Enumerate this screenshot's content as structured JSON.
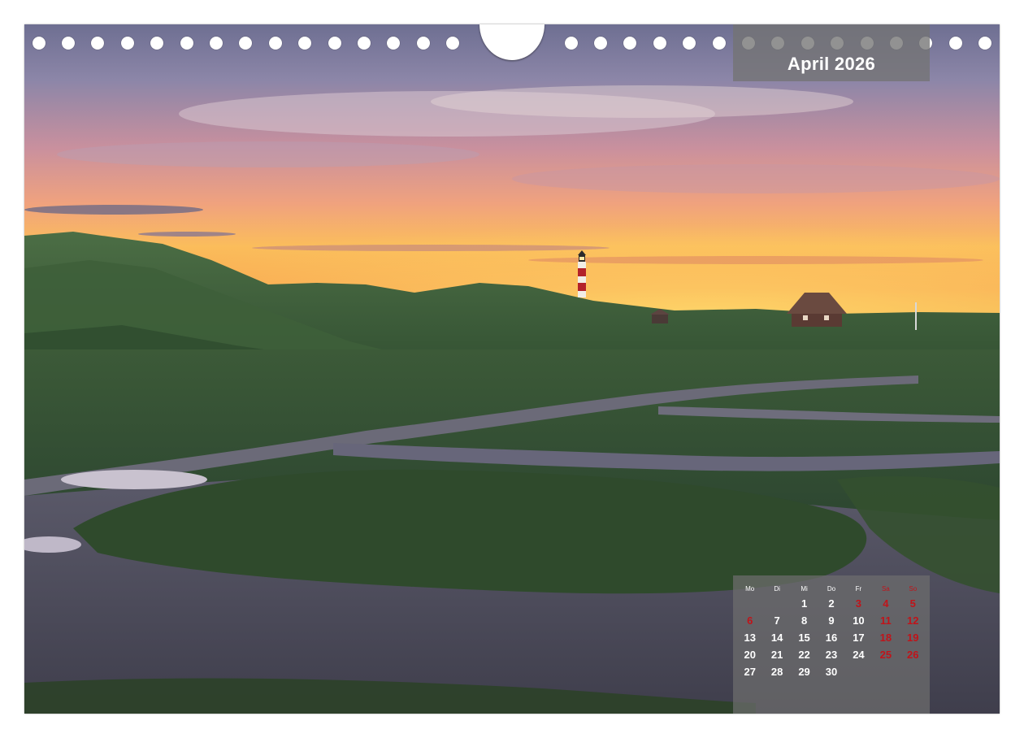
{
  "calendar": {
    "month_title": "April 2026",
    "weekdays": [
      "Mo",
      "Di",
      "Mi",
      "Do",
      "Fr",
      "Sa",
      "So"
    ],
    "weeks": [
      [
        "",
        "",
        "1",
        "2",
        "3",
        "4",
        "5"
      ],
      [
        "6",
        "7",
        "8",
        "9",
        "10",
        "11",
        "12"
      ],
      [
        "13",
        "14",
        "15",
        "16",
        "17",
        "18",
        "19"
      ],
      [
        "20",
        "21",
        "22",
        "23",
        "24",
        "25",
        "26"
      ],
      [
        "27",
        "28",
        "29",
        "30",
        "",
        "",
        ""
      ]
    ],
    "highlight_days": [
      "3",
      "4",
      "5",
      "6",
      "11",
      "12",
      "18",
      "19",
      "25",
      "26"
    ],
    "colors": {
      "highlight": "#c0141a",
      "text": "#ffffff",
      "panel": "#737373"
    }
  },
  "photo": {
    "icons": [
      "lighthouse-icon",
      "thatched-house-icon",
      "small-hut-icon"
    ]
  }
}
